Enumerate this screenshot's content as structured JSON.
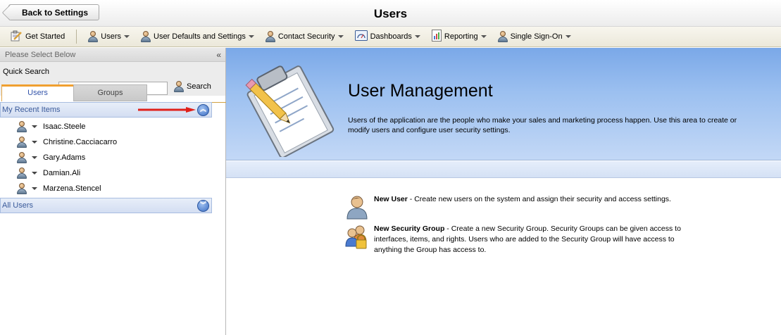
{
  "titlebar": {
    "back_label": "Back to Settings",
    "page_title": "Users"
  },
  "toolbar": {
    "items": [
      {
        "label": "Get Started",
        "icon": "get-started-icon",
        "dropdown": false
      },
      {
        "label": "Users",
        "icon": "user-icon",
        "dropdown": true
      },
      {
        "label": "User Defaults and Settings",
        "icon": "user-settings-icon",
        "dropdown": true
      },
      {
        "label": "Contact Security",
        "icon": "contact-security-icon",
        "dropdown": true
      },
      {
        "label": "Dashboards",
        "icon": "dashboard-icon",
        "dropdown": true
      },
      {
        "label": "Reporting",
        "icon": "reporting-icon",
        "dropdown": true
      },
      {
        "label": "Single Sign-On",
        "icon": "sso-icon",
        "dropdown": true
      }
    ]
  },
  "leftpanel": {
    "header": "Please Select Below",
    "collapse_glyph": "«",
    "quick_search_label": "Quick Search",
    "quick_search_value": "",
    "search_label": "Search",
    "tabs": [
      {
        "label": "Users",
        "active": true
      },
      {
        "label": "Groups",
        "active": false
      }
    ],
    "recent_header": "My Recent Items",
    "recent_items": [
      {
        "name": "Isaac.Steele"
      },
      {
        "name": "Christine.Cacciacarro"
      },
      {
        "name": "Gary.Adams"
      },
      {
        "name": "Damian.Ali"
      },
      {
        "name": "Marzena.Stencel"
      }
    ],
    "all_users_header": "All Users"
  },
  "main": {
    "title": "User Management",
    "description": "Users of the application are the people who make your sales and marketing process happen. Use this area to create or modify users and configure user security settings.",
    "actions": [
      {
        "title": "New User",
        "text": " - Create new users on the system and assign their security and access settings.",
        "icon": "new-user-icon"
      },
      {
        "title": "New Security Group",
        "text": " - Create a new Security Group. Security Groups can be given access to interfaces, items, and rights. Users who are added to the Security Group will have access to anything the Group has access to.",
        "icon": "security-group-icon"
      }
    ]
  },
  "colors": {
    "banner_top": "#7aa8e8",
    "banner_bottom": "#c3d8f6",
    "section_text": "#3a5a9a",
    "active_tab_accent": "#f0a030",
    "annotation_arrow": "#e0201a"
  }
}
